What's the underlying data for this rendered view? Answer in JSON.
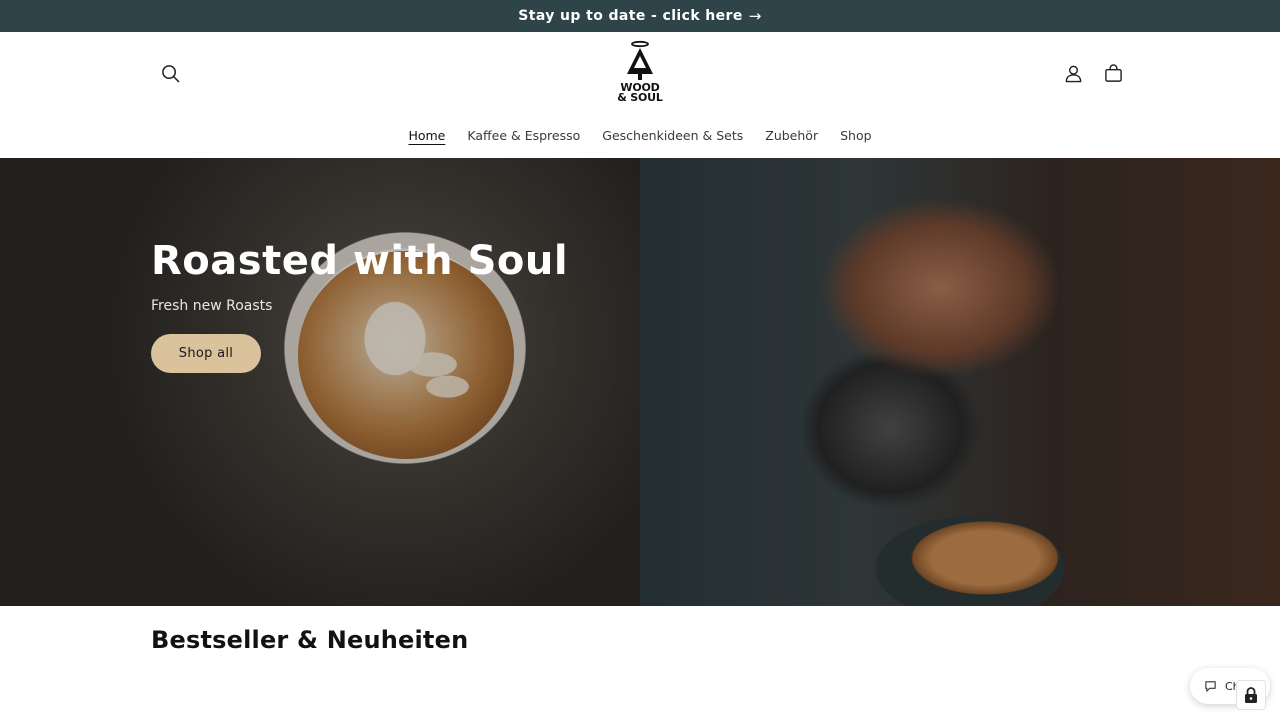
{
  "announcement": {
    "text": "Stay up to date - click here",
    "arrow": "→",
    "bg": "#2e4448"
  },
  "header": {
    "logo_text_line1": "WOOD",
    "logo_text_line2": "& SOUL",
    "icons": {
      "search": "search-icon",
      "account": "user-icon",
      "cart": "bag-icon"
    }
  },
  "nav": {
    "items": [
      {
        "label": "Home"
      },
      {
        "label": "Kaffee & Espresso"
      },
      {
        "label": "Geschenkideen & Sets"
      },
      {
        "label": "Zubehör"
      },
      {
        "label": "Shop"
      }
    ]
  },
  "hero": {
    "title": "Roasted with Soul",
    "subtitle": "Fresh new Roasts",
    "button_label": "Shop all",
    "button_color": "#d9c29c"
  },
  "section": {
    "title": "Bestseller & Neuheiten"
  },
  "chat": {
    "label": "Ch",
    "icon": "chat-bubble-icon"
  },
  "lock": {
    "icon": "lock-icon"
  }
}
